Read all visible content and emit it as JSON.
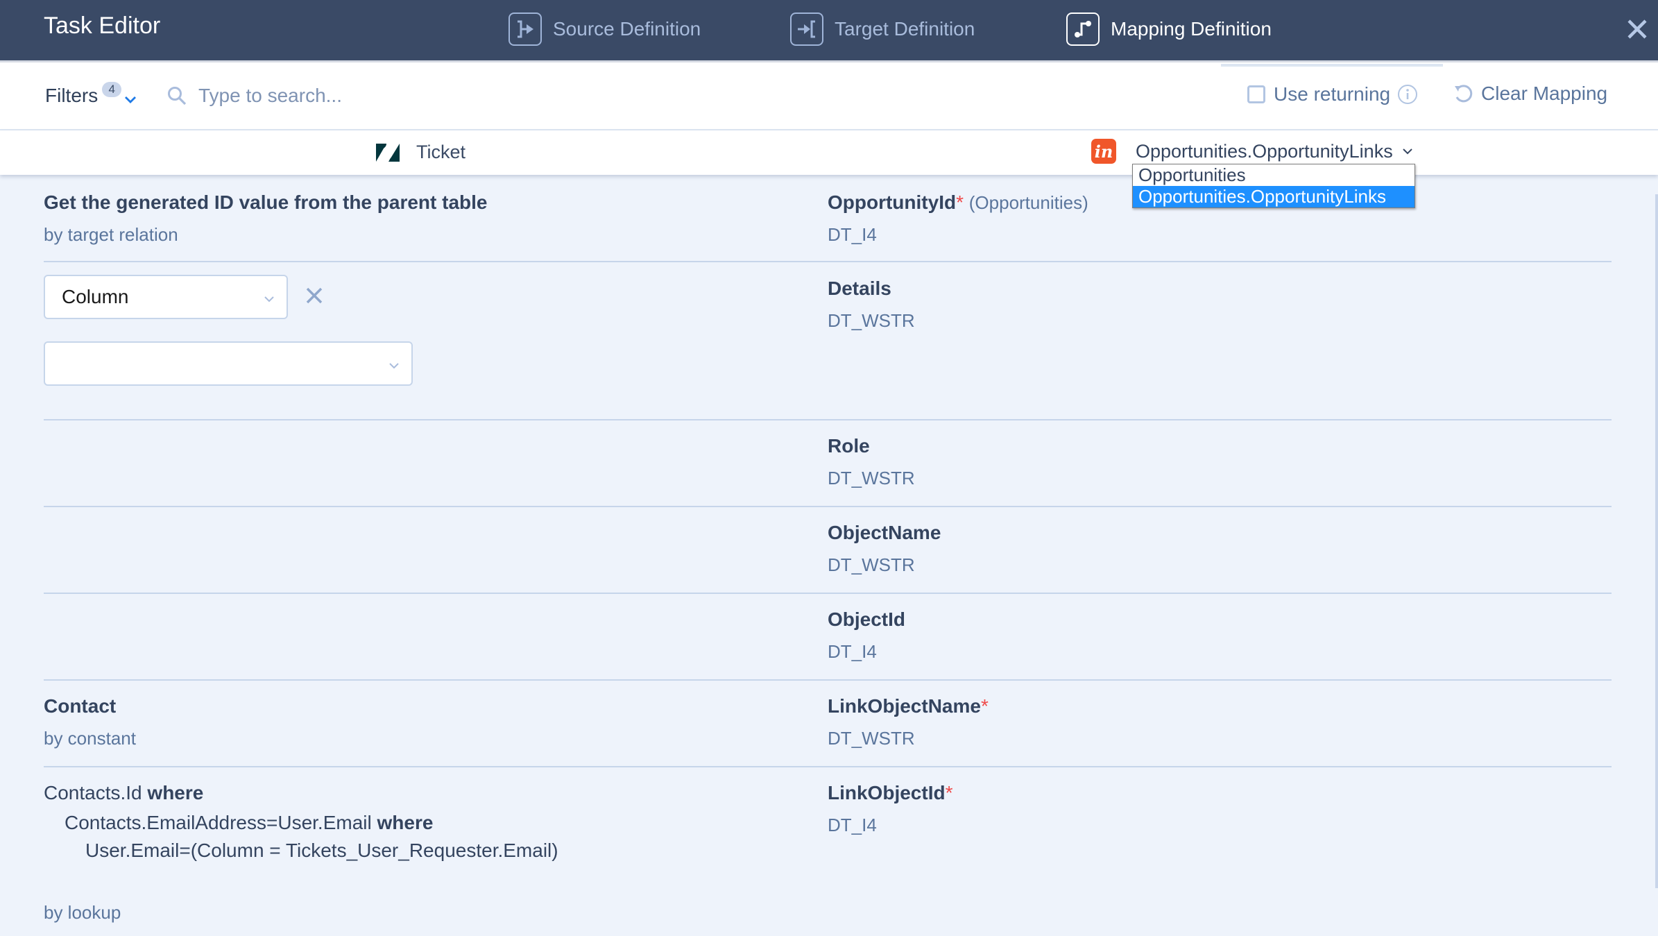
{
  "header": {
    "title": "Task Editor",
    "tabs": [
      {
        "label": "Source Definition",
        "icon": "source-definition-icon",
        "active": false
      },
      {
        "label": "Target Definition",
        "icon": "target-definition-icon",
        "active": false
      },
      {
        "label": "Mapping Definition",
        "icon": "mapping-definition-icon",
        "active": true
      }
    ],
    "close_icon": "close-icon"
  },
  "toolbar": {
    "filters_label": "Filters",
    "filters_count": "4",
    "search_placeholder": "Type to search...",
    "search_value": "",
    "use_returning_label": "Use returning",
    "use_returning_checked": false,
    "clear_mapping_label": "Clear Mapping"
  },
  "entities": {
    "source": {
      "name": "Ticket",
      "icon": "zendesk-logo-icon"
    },
    "target": {
      "selected": "Opportunities.OpportunityLinks",
      "icon": "insightly-logo-icon",
      "logo_text": "in",
      "options": [
        "Opportunities",
        "Opportunities.OpportunityLinks"
      ],
      "highlighted_option": "Opportunities.OpportunityLinks"
    }
  },
  "mappings": [
    {
      "source_title": "Get the generated ID value from the parent table",
      "source_kind": "by target relation",
      "target_name": "OpportunityId",
      "target_required": true,
      "target_context": "(Opportunities)",
      "target_type": "DT_I4"
    },
    {
      "source_select_1": "Column",
      "source_select_2": "",
      "target_name": "Details",
      "target_required": false,
      "target_type": "DT_WSTR"
    },
    {
      "target_name": "Role",
      "target_required": false,
      "target_type": "DT_WSTR"
    },
    {
      "target_name": "ObjectName",
      "target_required": false,
      "target_type": "DT_WSTR"
    },
    {
      "target_name": "ObjectId",
      "target_required": false,
      "target_type": "DT_I4"
    },
    {
      "source_title": "Contact",
      "source_kind": "by constant",
      "target_name": "LinkObjectName",
      "target_required": true,
      "target_type": "DT_WSTR"
    },
    {
      "source_lookup": [
        {
          "text": "Contacts.Id",
          "keyword": "where"
        },
        {
          "text": "Contacts.EmailAddress=User.Email",
          "keyword": "where"
        },
        {
          "text": "User.Email=(Column = Tickets_User_Requester.Email)",
          "keyword": ""
        }
      ],
      "source_kind": "by lookup",
      "target_name": "LinkObjectId",
      "target_required": true,
      "target_type": "DT_I4"
    }
  ],
  "required_marker": "*",
  "colors": {
    "header_bg": "#3a4a66",
    "accent_blue": "#1e90ff",
    "required_red": "#ef4b4b",
    "content_bg": "#eef3fb",
    "insightly_orange": "#f0562a",
    "zendesk_dark": "#03363d"
  }
}
